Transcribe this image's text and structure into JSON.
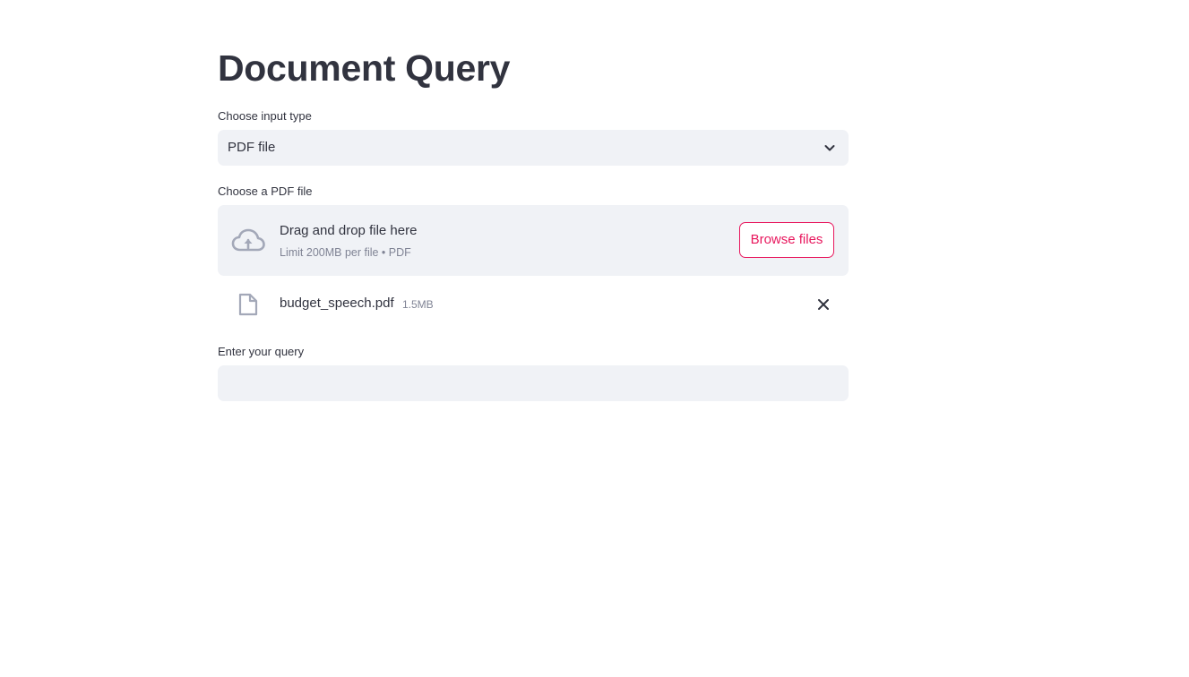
{
  "page": {
    "title": "Document Query"
  },
  "input_type": {
    "label": "Choose input type",
    "selected": "PDF file"
  },
  "uploader": {
    "label": "Choose a PDF file",
    "drop_text": "Drag and drop file here",
    "limit_text": "Limit 200MB per file • PDF",
    "browse_label": "Browse files"
  },
  "uploaded_file": {
    "name": "budget_speech.pdf",
    "size": "1.5MB"
  },
  "query": {
    "label": "Enter your query",
    "value": "",
    "placeholder": ""
  },
  "colors": {
    "accent": "#e8175d",
    "widget_bg": "#f0f2f6",
    "text": "#31333f",
    "muted_text": "#808495",
    "icon": "#a3a8b8"
  },
  "icons": {
    "select_chevron": "chevron-down-icon",
    "upload": "cloud-upload-icon",
    "file": "file-icon",
    "remove": "close-icon"
  }
}
